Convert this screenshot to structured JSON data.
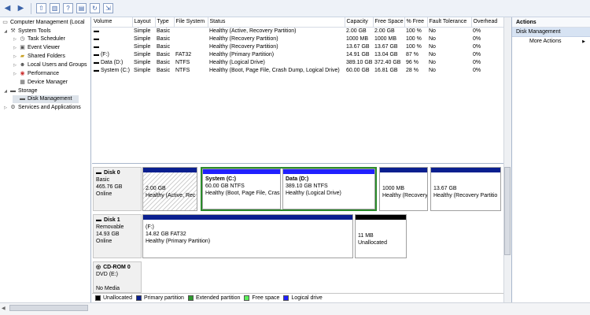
{
  "toolbar": {
    "buttons": [
      "back-icon",
      "forward-icon",
      "up-folder-icon",
      "show-hide-tree-icon",
      "help-icon",
      "properties-icon",
      "refresh-icon",
      "export-icon"
    ]
  },
  "tree": [
    {
      "label": "Computer Management (Local",
      "icon": "computer-icon",
      "level": 0
    },
    {
      "label": "System Tools",
      "icon": "tools-icon",
      "level": 1,
      "expanded": true
    },
    {
      "label": "Task Scheduler",
      "icon": "clock-icon",
      "level": 2
    },
    {
      "label": "Event Viewer",
      "icon": "event-icon",
      "level": 2
    },
    {
      "label": "Shared Folders",
      "icon": "folder-icon",
      "level": 2
    },
    {
      "label": "Local Users and Groups",
      "icon": "users-icon",
      "level": 2
    },
    {
      "label": "Performance",
      "icon": "performance-icon",
      "level": 2
    },
    {
      "label": "Device Manager",
      "icon": "device-icon",
      "level": 2
    },
    {
      "label": "Storage",
      "icon": "storage-icon",
      "level": 1,
      "expanded": true
    },
    {
      "label": "Disk Management",
      "icon": "disk-icon",
      "level": 2,
      "selected": true
    },
    {
      "label": "Services and Applications",
      "icon": "services-icon",
      "level": 1
    }
  ],
  "volumes": {
    "columns": [
      "Volume",
      "Layout",
      "Type",
      "File System",
      "Status",
      "Capacity",
      "Free Space",
      "% Free",
      "Fault Tolerance",
      "Overhead"
    ],
    "rows": [
      [
        "",
        "Simple",
        "Basic",
        "",
        "Healthy (Active, Recovery Partition)",
        "2.00 GB",
        "2.00 GB",
        "100 %",
        "No",
        "0%"
      ],
      [
        "",
        "Simple",
        "Basic",
        "",
        "Healthy (Recovery Partition)",
        "1000 MB",
        "1000 MB",
        "100 %",
        "No",
        "0%"
      ],
      [
        "",
        "Simple",
        "Basic",
        "",
        "Healthy (Recovery Partition)",
        "13.67 GB",
        "13.67 GB",
        "100 %",
        "No",
        "0%"
      ],
      [
        "(F:)",
        "Simple",
        "Basic",
        "FAT32",
        "Healthy (Primary Partition)",
        "14.91 GB",
        "13.04 GB",
        "87 %",
        "No",
        "0%"
      ],
      [
        "Data (D:)",
        "Simple",
        "Basic",
        "NTFS",
        "Healthy (Logical Drive)",
        "389.10 GB",
        "372.40 GB",
        "96 %",
        "No",
        "0%"
      ],
      [
        "System (C:)",
        "Simple",
        "Basic",
        "NTFS",
        "Healthy (Boot, Page File, Crash Dump, Logical Drive)",
        "60.00 GB",
        "16.81 GB",
        "28 %",
        "No",
        "0%"
      ]
    ]
  },
  "disks": [
    {
      "name": "Disk 0",
      "lines": [
        "Basic",
        "465.76 GB",
        "Online"
      ]
    },
    {
      "name": "Disk 1",
      "lines": [
        "Removable",
        "14.93 GB",
        "Online"
      ]
    },
    {
      "name": "CD-ROM 0",
      "lines": [
        "DVD (E:)",
        "",
        "No Media"
      ]
    }
  ],
  "partitions": {
    "d0p1": {
      "title": "",
      "size": "2.00 GB",
      "status": "Healthy (Active, Rec"
    },
    "d0p2": {
      "title": "System  (C:)",
      "size": "60.00 GB NTFS",
      "status": "Healthy (Boot, Page File, Cras"
    },
    "d0p3": {
      "title": "Data  (D:)",
      "size": "389.10 GB NTFS",
      "status": "Healthy (Logical Drive)"
    },
    "d0p4": {
      "title": "",
      "size": "1000 MB",
      "status": "Healthy (Recovery"
    },
    "d0p5": {
      "title": "",
      "size": "13.67 GB",
      "status": "Healthy (Recovery Partitio"
    },
    "d1p1": {
      "title": "(F:)",
      "size": "14.82 GB FAT32",
      "status": "Healthy (Primary Partition)"
    },
    "d1p2": {
      "title": "",
      "size": "11 MB",
      "status": "Unallocated"
    }
  },
  "legend": [
    {
      "label": "Unallocated",
      "color": "#000000"
    },
    {
      "label": "Primary partition",
      "color": "#0a1f8f"
    },
    {
      "label": "Extended partition",
      "color": "#2e9b2e"
    },
    {
      "label": "Free space",
      "color": "#5cf05c"
    },
    {
      "label": "Logical drive",
      "color": "#2020ff"
    }
  ],
  "actions": {
    "header": "Actions",
    "section": "Disk Management",
    "more": "More Actions"
  },
  "colors": {
    "primary": "#0a1f8f",
    "logical": "#2020ff",
    "unallocated": "#000000",
    "extended": "#2e9b2e"
  }
}
